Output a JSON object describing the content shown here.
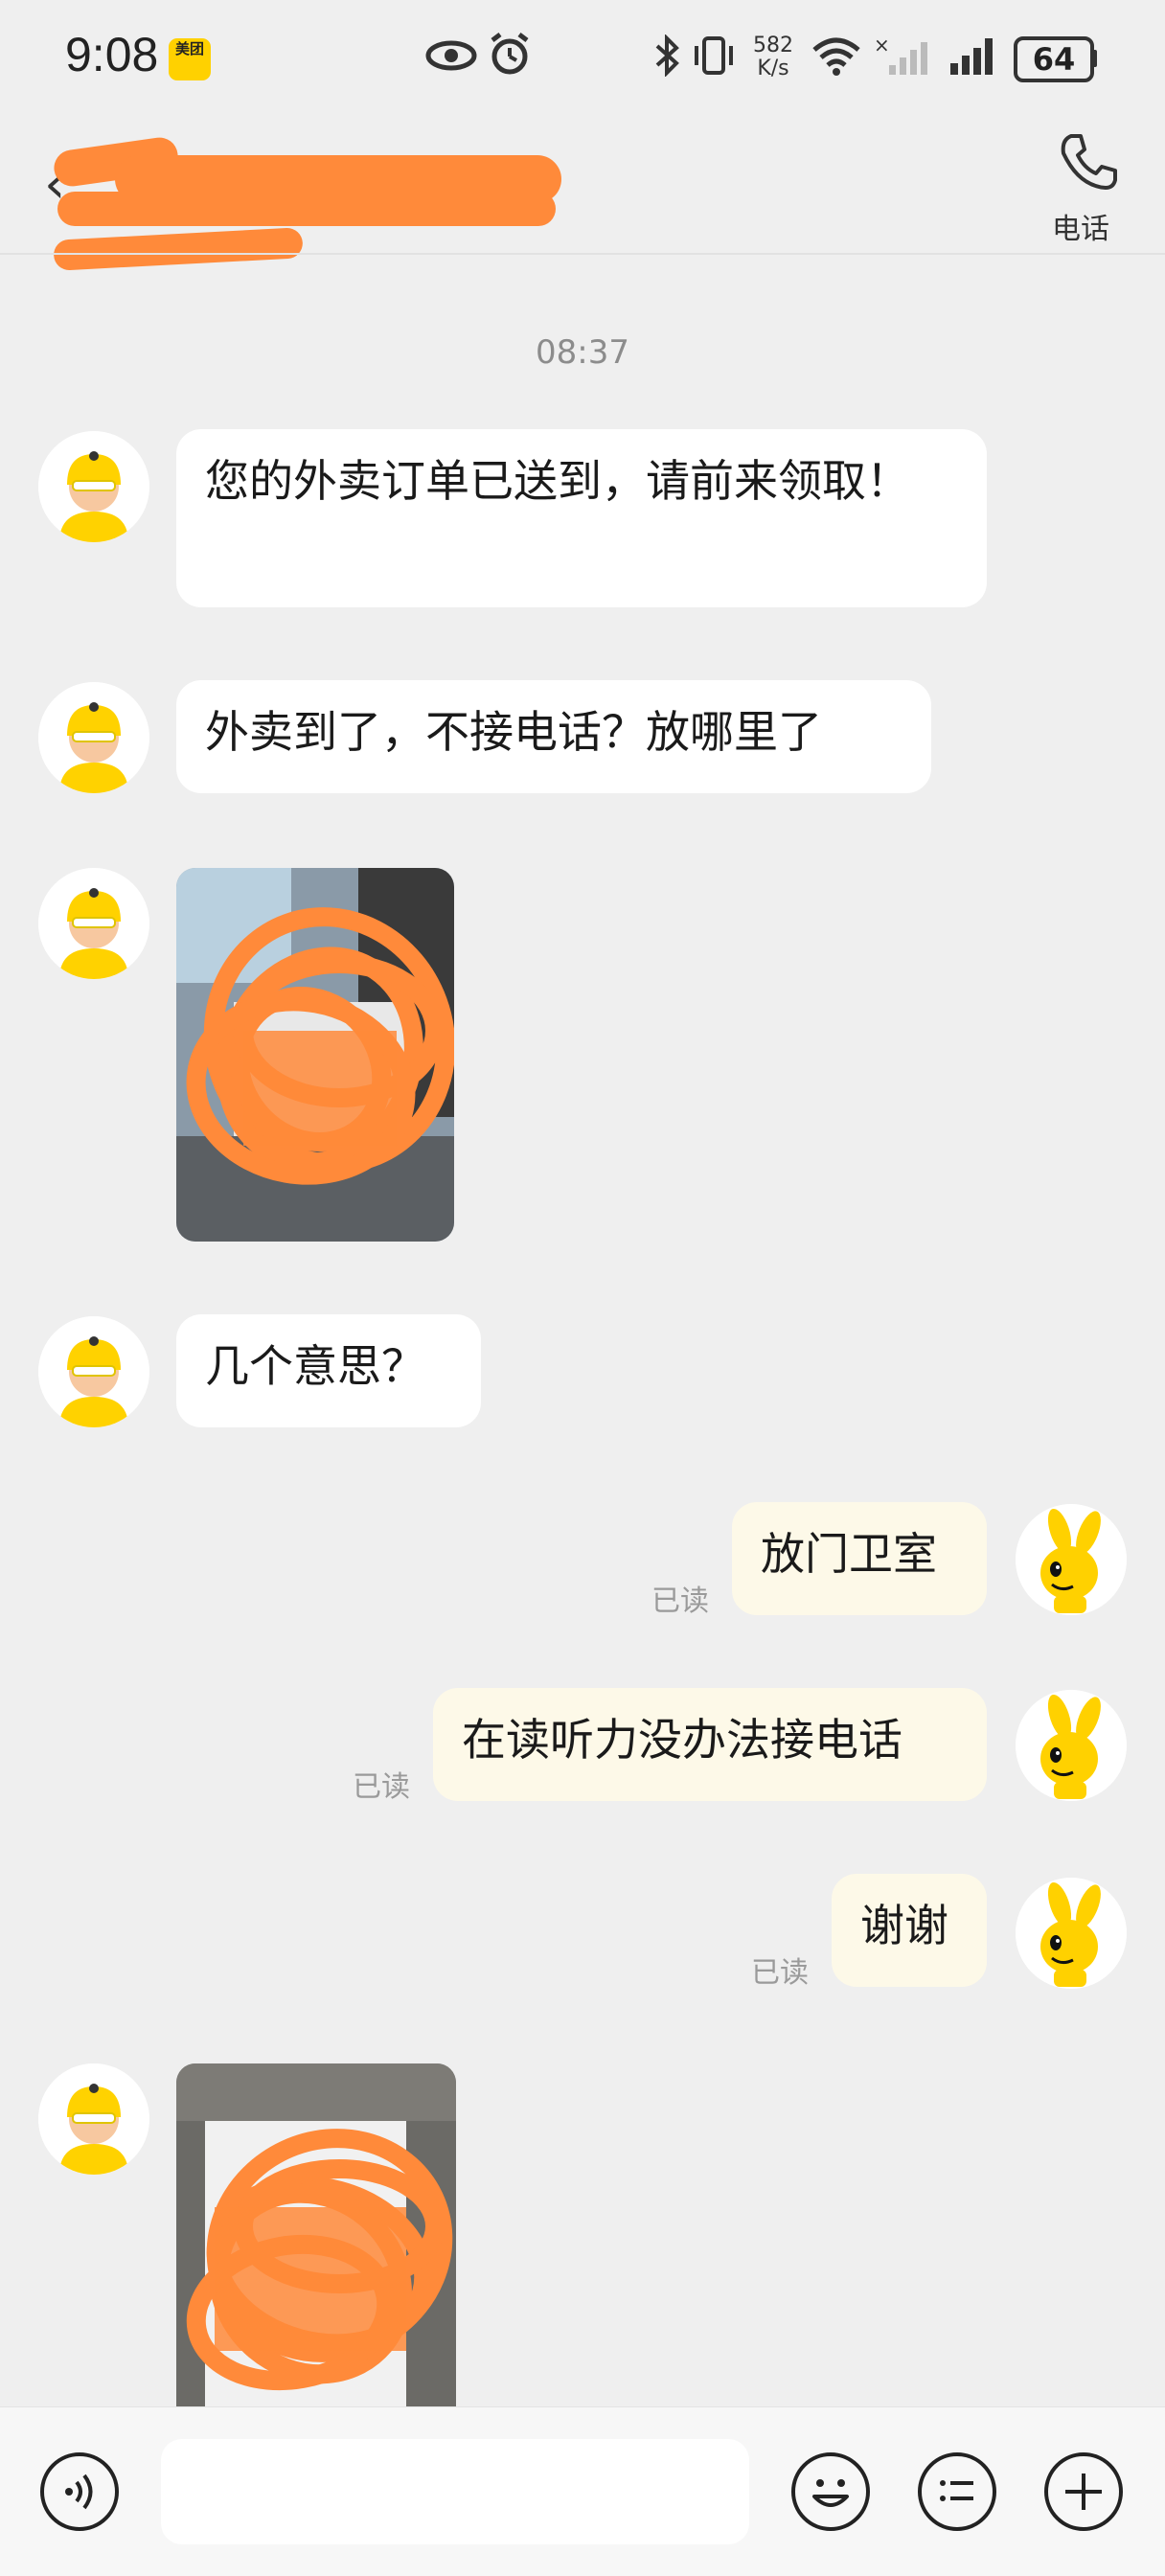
{
  "status_bar": {
    "time": "9:08",
    "app_badge": "美团",
    "net_speed_value": "582",
    "net_speed_unit": "K/s",
    "battery": "64"
  },
  "header": {
    "call_label": "电话"
  },
  "conversation": {
    "timestamp": "08:37",
    "messages": [
      {
        "from": "rider",
        "type": "text",
        "text": "您的外卖订单已送到，请前来领取！"
      },
      {
        "from": "rider",
        "type": "text",
        "text": "外卖到了，不接电话？放哪里了"
      },
      {
        "from": "rider",
        "type": "image"
      },
      {
        "from": "rider",
        "type": "text",
        "text": "几个意思？"
      },
      {
        "from": "me",
        "type": "text",
        "text": "放门卫室",
        "status": "已读"
      },
      {
        "from": "me",
        "type": "text",
        "text": "在读听力没办法接电话",
        "status": "已读"
      },
      {
        "from": "me",
        "type": "text",
        "text": "谢谢",
        "status": "已读"
      },
      {
        "from": "rider",
        "type": "image"
      }
    ]
  },
  "input_bar": {
    "icons": [
      "voice-icon",
      "emoji-icon",
      "quick-reply-icon",
      "plus-icon"
    ]
  },
  "colors": {
    "background": "#efefef",
    "incoming_bubble": "#ffffff",
    "outgoing_bubble": "#fdf9e8",
    "redaction": "#ff8a3a",
    "brand_yellow": "#ffd100"
  }
}
